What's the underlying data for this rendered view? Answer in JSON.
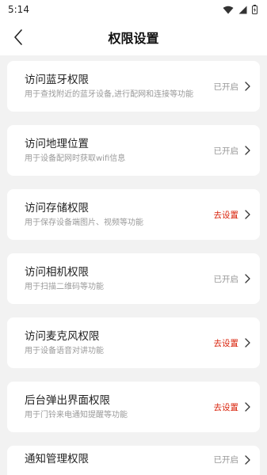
{
  "status_bar": {
    "time": "5:14"
  },
  "header": {
    "title": "权限设置"
  },
  "permissions": [
    {
      "title": "访问蓝牙权限",
      "desc": "用于查找附近的蓝牙设备,进行配网和连接等功能",
      "status": "已开启",
      "warn": false
    },
    {
      "title": "访问地理位置",
      "desc": "用于设备配网时获取wifi信息",
      "status": "已开启",
      "warn": false
    },
    {
      "title": "访问存储权限",
      "desc": "用于保存设备端图片、视频等功能",
      "status": "去设置",
      "warn": true
    },
    {
      "title": "访问相机权限",
      "desc": "用于扫描二维码等功能",
      "status": "已开启",
      "warn": false
    },
    {
      "title": "访问麦克风权限",
      "desc": "用于设备语音对讲功能",
      "status": "去设置",
      "warn": true
    },
    {
      "title": "后台弹出界面权限",
      "desc": "用于门铃来电通知提醒等功能",
      "status": "去设置",
      "warn": true
    },
    {
      "title": "通知管理权限",
      "desc": "",
      "status": "已开启",
      "warn": false
    }
  ],
  "colors": {
    "warn": "#d81e06",
    "muted": "#999999",
    "background": "#f2f2f2"
  },
  "icons": {
    "back": "chevron-left-icon",
    "row": "chevron-right-icon"
  }
}
